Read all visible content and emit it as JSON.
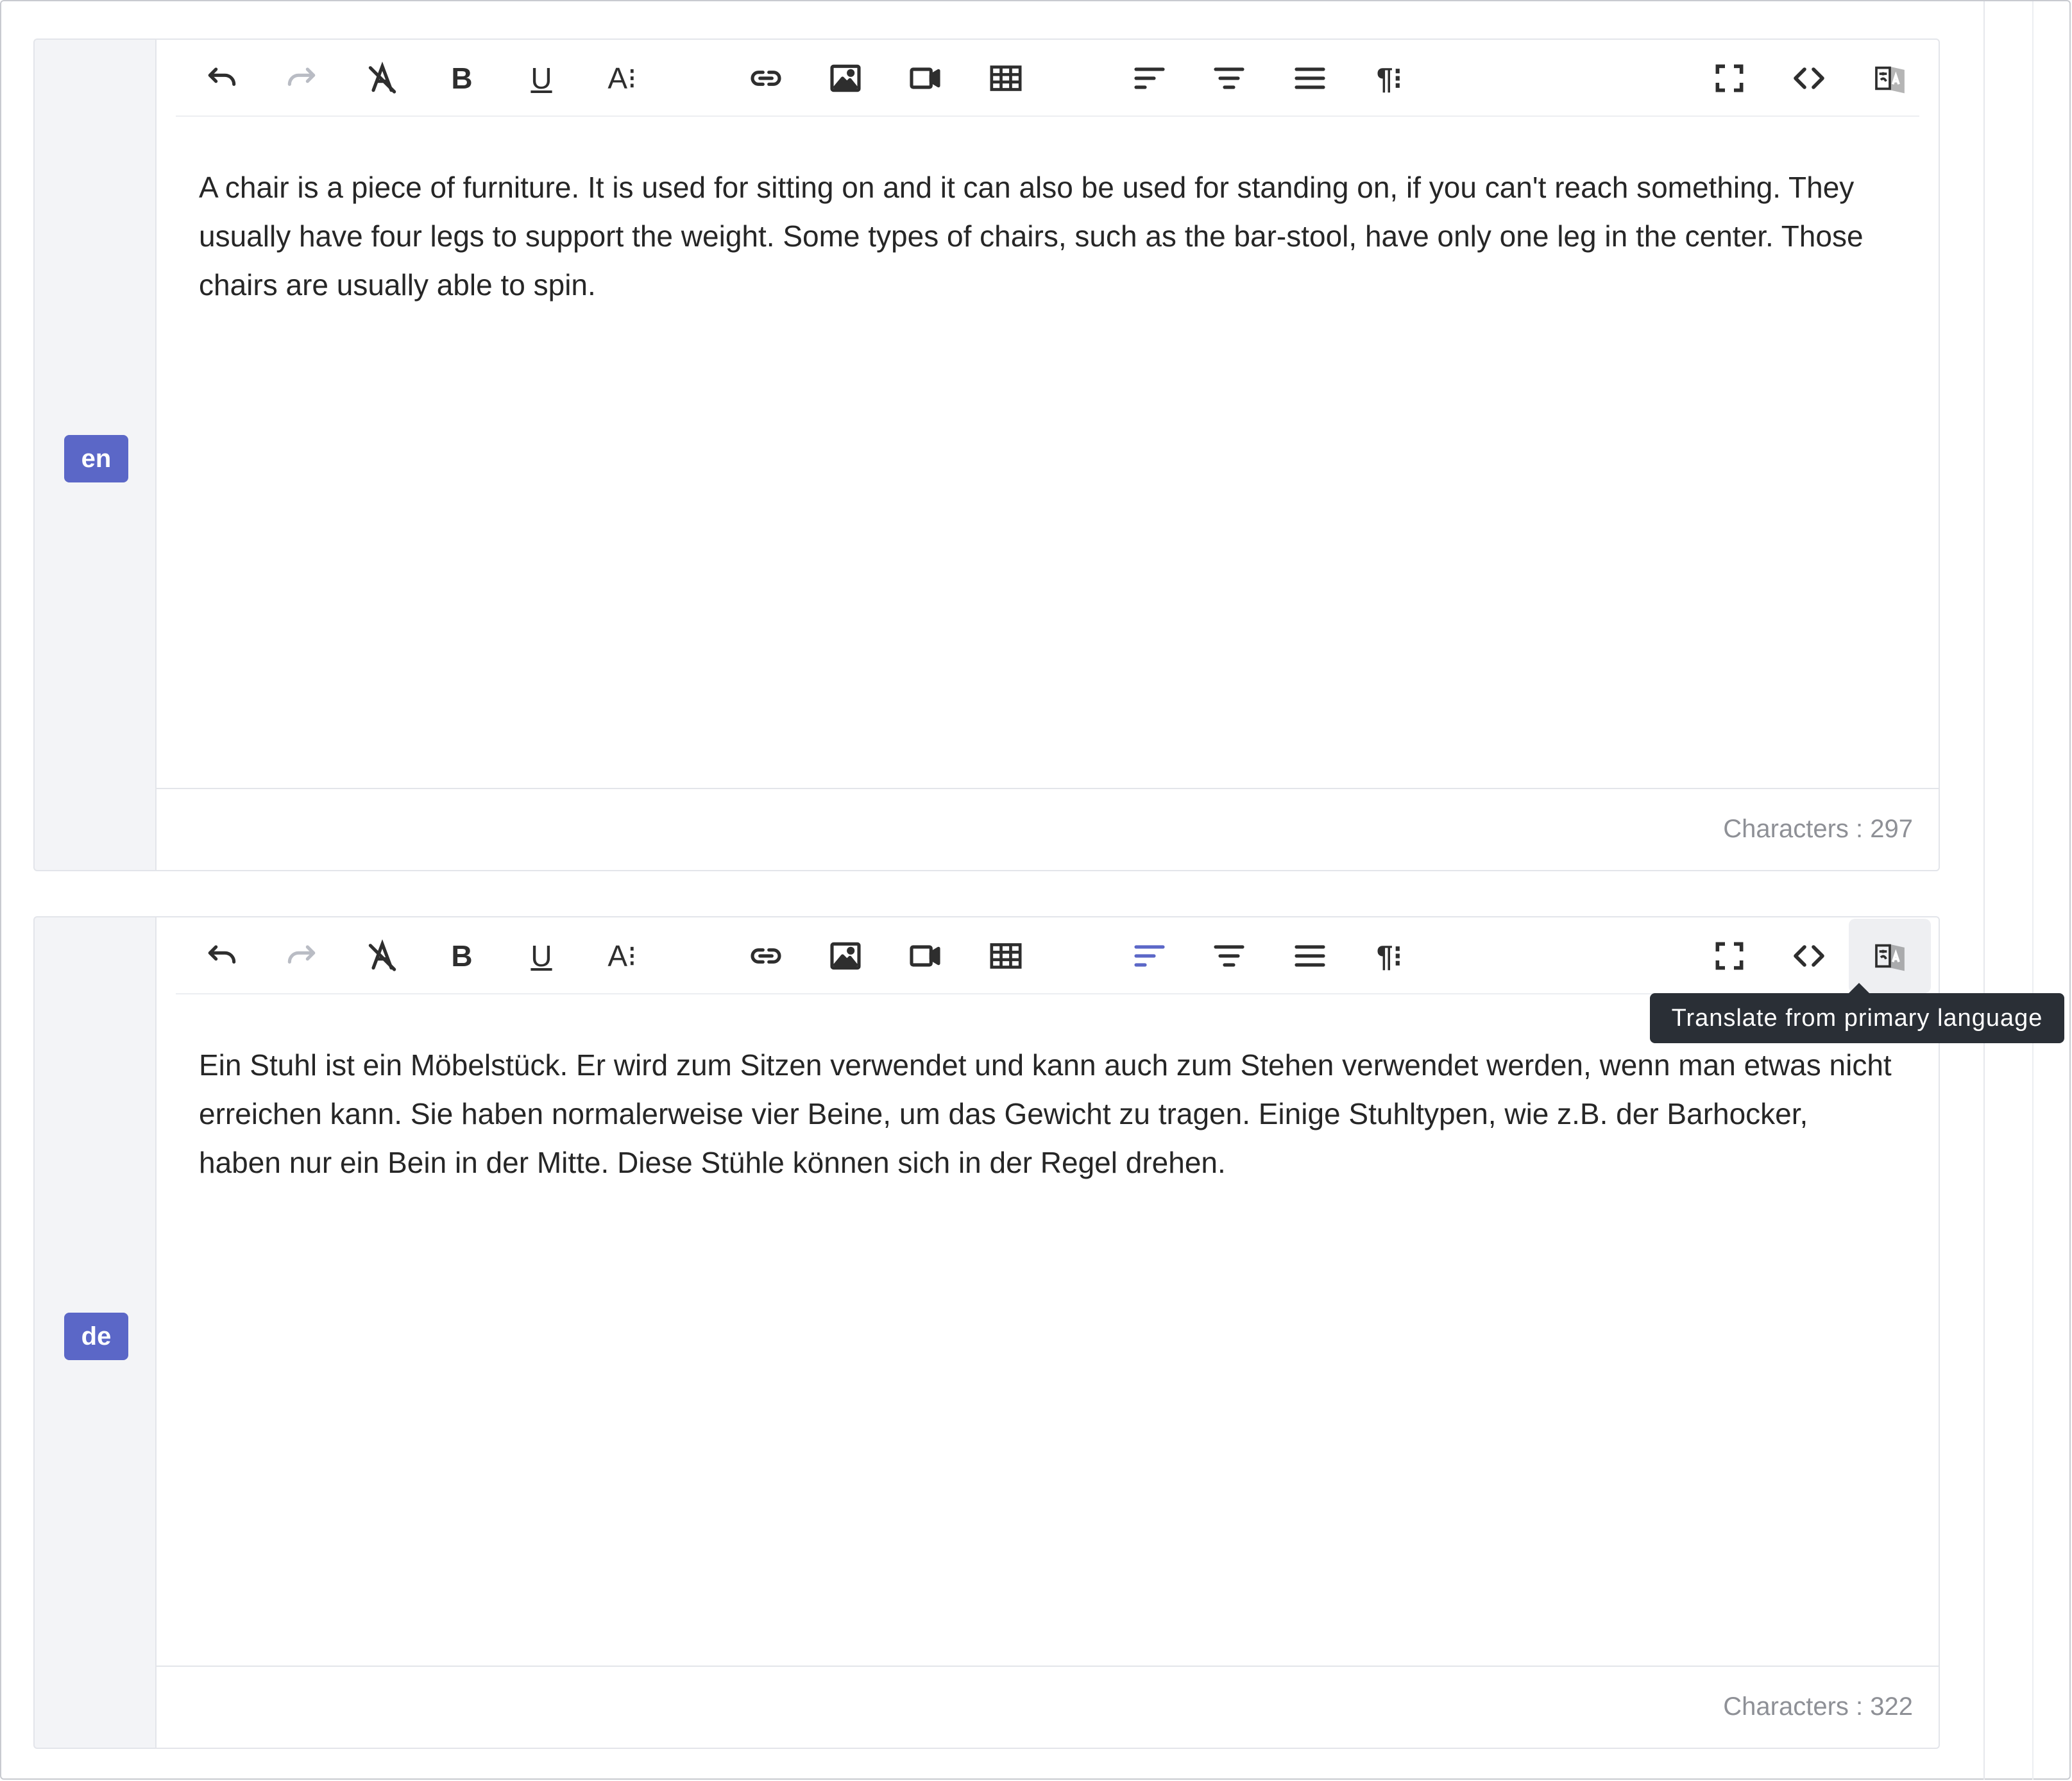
{
  "accent_color": "#5b67c7",
  "toolbar_icons": [
    "undo-icon",
    "redo-icon",
    "clear-formatting-icon",
    "bold-icon",
    "underline-icon",
    "font-size-icon",
    "link-icon",
    "image-icon",
    "video-icon",
    "table-icon",
    "align-left-icon",
    "align-center-icon",
    "justify-icon",
    "paragraph-format-icon",
    "fullscreen-icon",
    "code-view-icon",
    "translate-icon"
  ],
  "toolbar_text": {
    "bold": "B",
    "underline": "U",
    "font_size": "A⁝",
    "paragraph": "¶⁝"
  },
  "editors": [
    {
      "language": "en",
      "content": "A chair is a piece of furniture. It is used for sitting on and it can also be used for standing on, if you can't reach something. They usually have four legs to support the weight. Some types of chairs, such as the bar-stool, have only one leg in the center. Those chairs are usually able to spin.",
      "char_count": "Characters : 297"
    },
    {
      "language": "de",
      "content": "Ein Stuhl ist ein Möbelstück. Er wird zum Sitzen verwendet und kann auch zum Stehen verwendet werden, wenn man etwas nicht erreichen kann. Sie haben normalerweise vier Beine, um das Gewicht zu tragen. Einige Stuhltypen, wie z.B. der Barhocker, haben nur ein Bein in der Mitte. Diese Stühle können sich in der Regel drehen.",
      "char_count": "Characters : 322"
    }
  ],
  "tooltip": "Translate from primary language"
}
